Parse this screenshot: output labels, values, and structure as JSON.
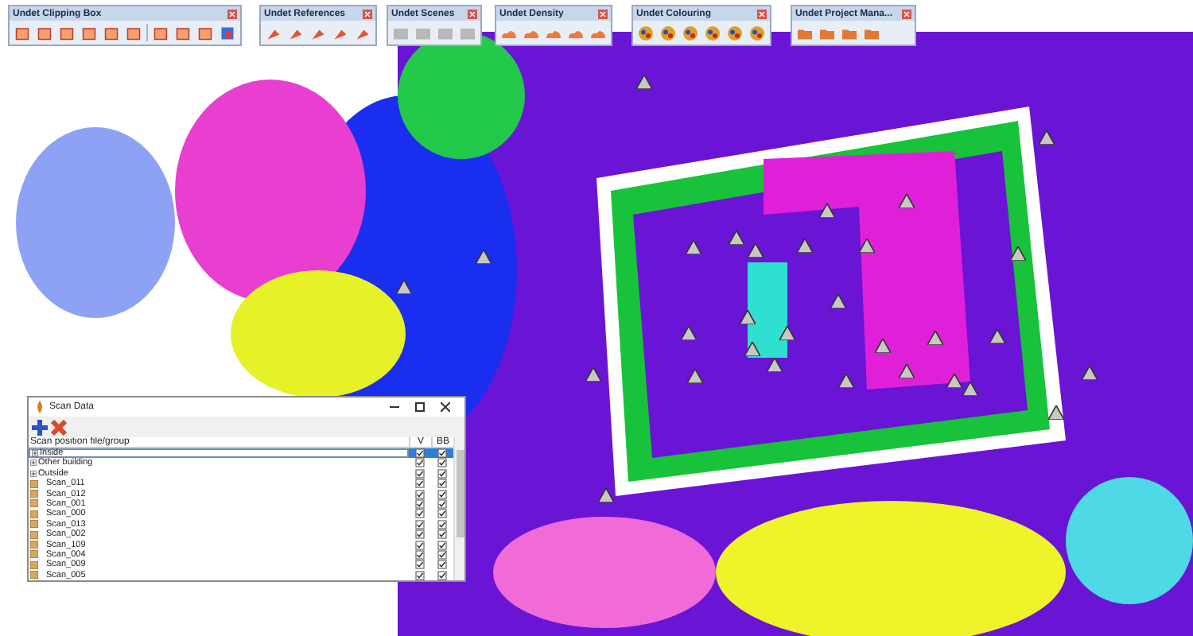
{
  "toolbars": [
    {
      "title": "Undet Clipping Box",
      "tools": [
        {
          "kind": "box"
        },
        {
          "kind": "box"
        },
        {
          "kind": "box"
        },
        {
          "kind": "box"
        },
        {
          "kind": "box"
        },
        {
          "kind": "box"
        },
        {
          "kind": "sep"
        },
        {
          "kind": "box"
        },
        {
          "kind": "box"
        },
        {
          "kind": "box"
        },
        {
          "kind": "cube"
        }
      ]
    },
    {
      "title": "Undet References",
      "tools": [
        {
          "kind": "arrow"
        },
        {
          "kind": "arrow"
        },
        {
          "kind": "arrow"
        },
        {
          "kind": "arrow"
        },
        {
          "kind": "arrow"
        }
      ]
    },
    {
      "title": "Undet Scenes",
      "tools": [
        {
          "kind": "film"
        },
        {
          "kind": "film"
        },
        {
          "kind": "film"
        },
        {
          "kind": "film"
        }
      ]
    },
    {
      "title": "Undet Density",
      "tools": [
        {
          "kind": "cloud"
        },
        {
          "kind": "cloud"
        },
        {
          "kind": "cloud"
        },
        {
          "kind": "cloud"
        },
        {
          "kind": "cloud"
        }
      ]
    },
    {
      "title": "Undet Colouring",
      "tools": [
        {
          "kind": "palette"
        },
        {
          "kind": "palette"
        },
        {
          "kind": "palette"
        },
        {
          "kind": "palette"
        },
        {
          "kind": "palette"
        },
        {
          "kind": "palette"
        }
      ]
    },
    {
      "title": "Undet Project Mana...",
      "tools": [
        {
          "kind": "folder"
        },
        {
          "kind": "folder"
        },
        {
          "kind": "folder"
        },
        {
          "kind": "folder"
        }
      ]
    }
  ],
  "scan_data": {
    "title": "Scan Data",
    "columns": [
      "Scan position file/group",
      "V",
      "BB"
    ],
    "rows": [
      {
        "label": "Inside",
        "kind": "group",
        "selected": true,
        "v_checked": true,
        "bb_checked": true
      },
      {
        "label": "Other building",
        "kind": "group",
        "selected": false,
        "v_checked": true,
        "bb_checked": true
      },
      {
        "label": "Outside",
        "kind": "group",
        "selected": false,
        "v_checked": true,
        "bb_checked": true
      },
      {
        "label": "Scan_011",
        "kind": "scan",
        "selected": false,
        "v_checked": true,
        "bb_checked": true
      },
      {
        "label": "Scan_012",
        "kind": "scan",
        "selected": false,
        "v_checked": true,
        "bb_checked": true
      },
      {
        "label": "Scan_001",
        "kind": "scan",
        "selected": false,
        "v_checked": true,
        "bb_checked": true
      },
      {
        "label": "Scan_000",
        "kind": "scan",
        "selected": false,
        "v_checked": true,
        "bb_checked": true
      },
      {
        "label": "Scan_013",
        "kind": "scan",
        "selected": false,
        "v_checked": true,
        "bb_checked": true
      },
      {
        "label": "Scan_002",
        "kind": "scan",
        "selected": false,
        "v_checked": true,
        "bb_checked": true
      },
      {
        "label": "Scan_109",
        "kind": "scan",
        "selected": false,
        "v_checked": true,
        "bb_checked": true
      },
      {
        "label": "Scan_004",
        "kind": "scan",
        "selected": false,
        "v_checked": true,
        "bb_checked": true
      },
      {
        "label": "Scan_009",
        "kind": "scan",
        "selected": false,
        "v_checked": true,
        "bb_checked": true
      },
      {
        "label": "Scan_005",
        "kind": "scan",
        "selected": false,
        "v_checked": true,
        "bb_checked": true
      }
    ]
  }
}
